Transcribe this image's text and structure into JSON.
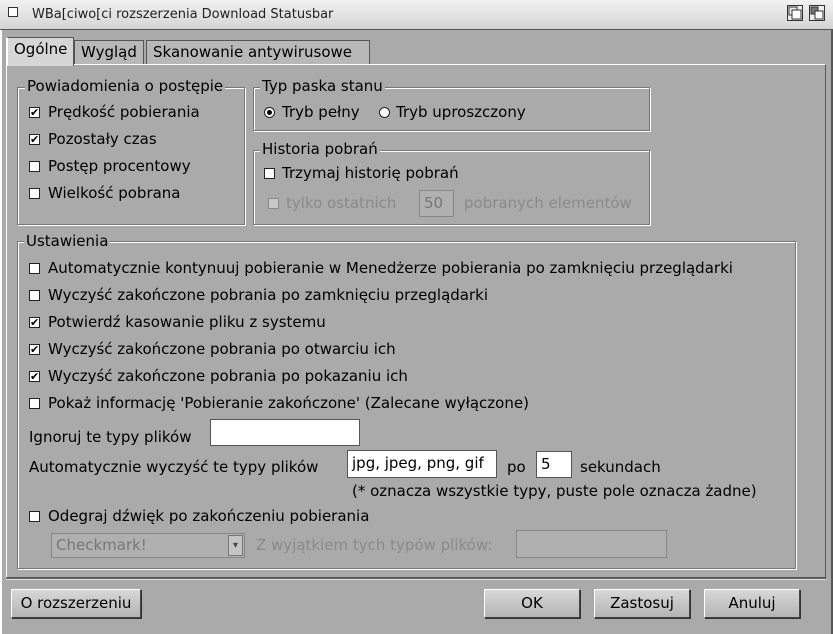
{
  "window": {
    "title": "WBa[ciwo[ci rozszerzenia Download Statusbar"
  },
  "tabs": [
    {
      "label": "Ogólne",
      "active": true
    },
    {
      "label": "Wygląd",
      "active": false
    },
    {
      "label": "Skanowanie antywirusowe",
      "active": false
    }
  ],
  "progress_group": {
    "title": "Powiadomienia o postępie",
    "items": [
      {
        "label": "Prędkość pobierania",
        "checked": "✔"
      },
      {
        "label": "Pozostały czas",
        "checked": "✔"
      },
      {
        "label": "Postęp procentowy",
        "checked": ""
      },
      {
        "label": "Wielkość pobrana",
        "checked": ""
      }
    ]
  },
  "statusbar_group": {
    "title": "Typ paska stanu",
    "options": [
      {
        "label": "Tryb pełny",
        "selected": true
      },
      {
        "label": "Tryb uproszczony",
        "selected": false
      }
    ]
  },
  "history_group": {
    "title": "Historia pobrań",
    "keep_label": "Trzymaj historię pobrań",
    "only_last_label": "tylko ostatnich",
    "count_value": "50",
    "items_label": "pobranych elementów"
  },
  "settings_group": {
    "title": "Ustawienia",
    "options": [
      {
        "label": "Automatycznie kontynuuj pobieranie w Menedżerze pobierania po zamknięciu przeglądarki",
        "checked": ""
      },
      {
        "label": "Wyczyść zakończone pobrania po zamknięciu przeglądarki",
        "checked": ""
      },
      {
        "label": "Potwierdź kasowanie pliku z systemu",
        "checked": "✔"
      },
      {
        "label": "Wyczyść zakończone pobrania po otwarciu ich",
        "checked": "✔"
      },
      {
        "label": "Wyczyść zakończone pobrania po pokazaniu ich",
        "checked": "✔"
      },
      {
        "label": "Pokaż informację 'Pobieranie zakończone' (Zalecane wyłączone)",
        "checked": ""
      }
    ],
    "ignore_label": "Ignoruj te typy plików",
    "ignore_value": "",
    "auto_clear_label": "Automatycznie wyczyść te typy plików",
    "auto_clear_value": "jpg, jpeg, png, gif",
    "po_label": "po",
    "seconds_value": "5",
    "seconds_label": "sekundach",
    "note": "(* oznacza wszystkie typy, puste pole oznacza żadne)",
    "sound_label": "Odegraj dźwięk po zakończeniu pobierania",
    "sound_checked": "",
    "sound_select": "Checkmark!",
    "except_label": "Z wyjątkiem tych typów plików:",
    "except_value": ""
  },
  "buttons": {
    "about": "O rozszerzeniu",
    "ok": "OK",
    "apply": "Zastosuj",
    "cancel": "Anuluj"
  }
}
